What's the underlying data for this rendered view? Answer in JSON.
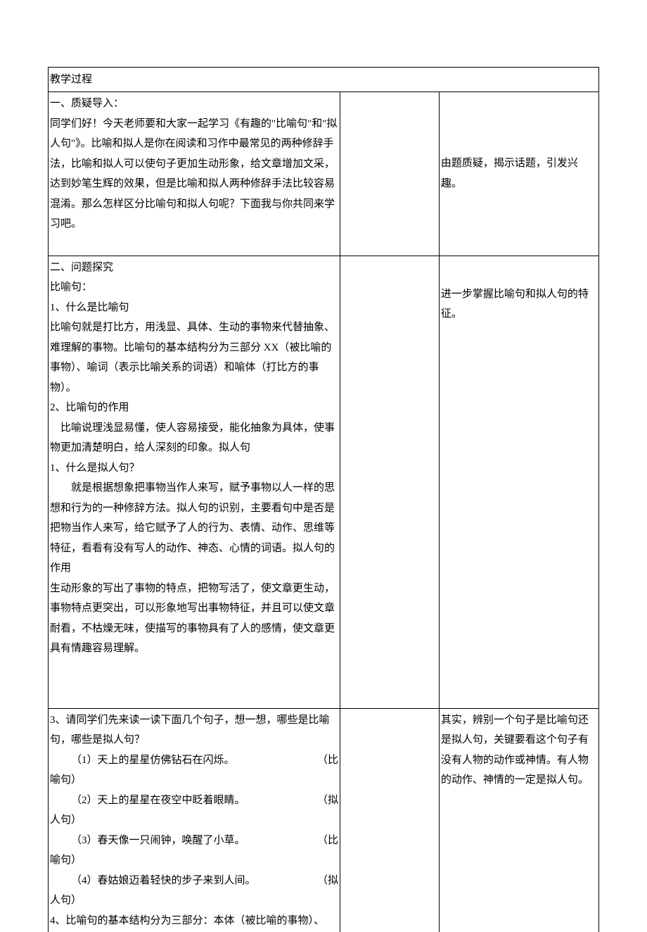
{
  "header": {
    "title": "教学过程"
  },
  "section1": {
    "title": "一、质疑导入：",
    "body": "同学们好！今天老师要和大家一起学习《有趣的\"比喻句\"和\"拟人句\"》。比喻和拟人是你在阅读和习作中最常见的两种修辞手法，比喻和拟人可以使句子更加生动形象，给文章增加文采，达到妙笔生辉的效果，但是比喻和拟人两种修辞手法比较容易混淆。那么怎样区分比喻句和拟人句呢？下面我与你共同来学习吧。",
    "note": "由题质疑，揭示话题，引发兴趣。"
  },
  "section2": {
    "title": "二、问题探究",
    "biyu_title": "比喻句：",
    "b1_title": "1、什么是比喻句",
    "b1_body": "比喻句就是打比方，用浅显、具体、生动的事物来代替抽象、难理解的事物。比喻句的基本结构分为三部分  XX（被比喻的事物）、喻词（表示比喻关系的词语）和喻体（打比方的事物）。",
    "b2_title": "2、比喻句的作用",
    "b2_body": "比喻说理浅显易懂，使人容易接受，能化抽象为具体，使事物更加清楚明白，给人深刻的印象。拟人句",
    "n1_title": "1、什么是拟人句？",
    "n1_body": "就是根据想象把事物当作人来写，赋予事物以人一样的思想和行为的一种修辞方法。拟人句的识别，主要看句中是否是把物当作人来写，给它赋予了人的行为、表情、动作、思维等特征，看看有没有写人的动作、神态、心情的词语。拟人句的作用",
    "n1_body2": "生动形象的写出了事物的特点，把物写活了，使文章更生动，事物特点更突出，可以形象地写出事物特征，并且可以使文章耐看，不枯燥无味，使描写的事物具有了人的感情，使文章更具有情趣容易理解。",
    "note": "进一步掌握比喻句和拟人句的特征。"
  },
  "section3": {
    "q3_title": "3、请同学们先来读一读下面几个句子，想一想，哪些是比喻句，哪些是拟人句？",
    "ex1": "（1）天上的星星仿佛钻石在闪烁。",
    "ex1_tag": "（比",
    "ex1_end": "喻句）",
    "ex2": "（2）天上的星星在夜空中眨着眼睛。",
    "ex2_tag": "（拟",
    "ex2_end": "人句）",
    "ex3": "（3）春天像一只闹钟，唤醒了小草。",
    "ex3_tag": "（比",
    "ex3_end": "喻句）",
    "ex4": "（4）春姑娘迈着轻快的步子来到人间。",
    "ex4_tag": "（拟",
    "ex4_end": "人句）",
    "q4": "4、比喻句的基本结构分为三部分：本体（被比喻的事物）、",
    "note": "其实，辨别一个句子是比喻句还是拟人句，关键要看这个句子有没有人物的动作或神情。有人物的动作、神情的一定是拟人句。"
  }
}
